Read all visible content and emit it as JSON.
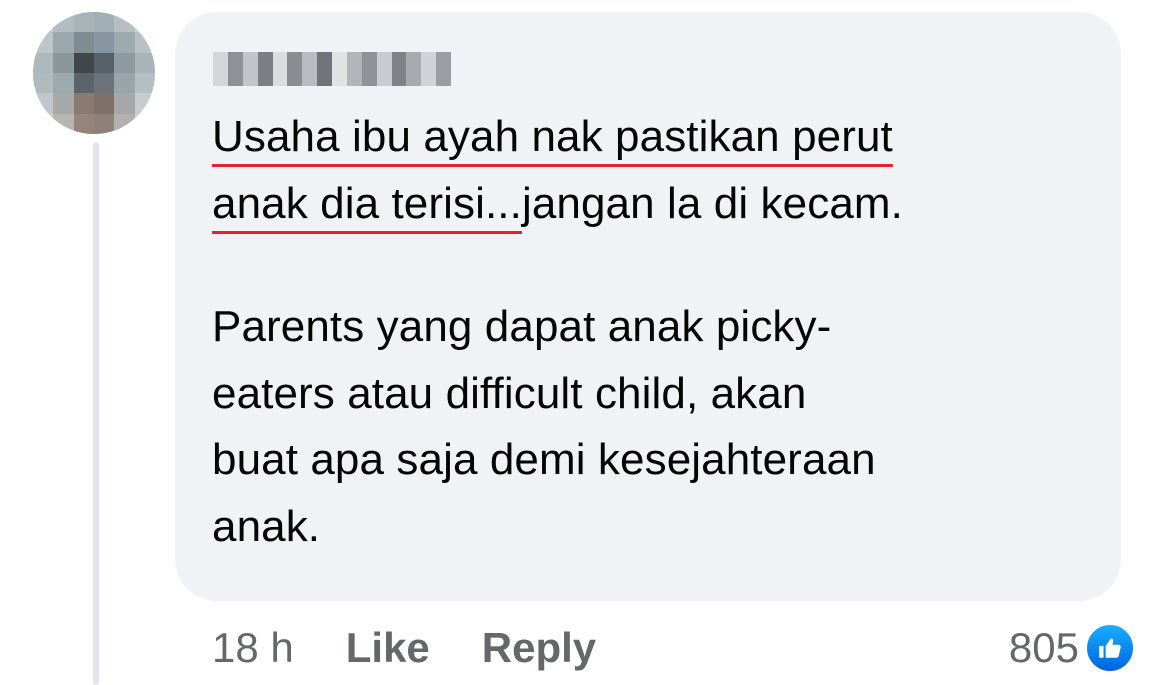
{
  "comment": {
    "author_name": "Author name (pixelated)",
    "paragraphs": [
      {
        "lines": [
          {
            "text": "Usaha ibu ayah nak pastikan perut",
            "underlined": true
          },
          {
            "underlined_part": "anak dia terisi...",
            "text": "jangan la di kecam."
          }
        ]
      },
      {
        "lines": [
          {
            "text": "Parents yang dapat anak picky-"
          },
          {
            "text": "eaters atau difficult child, akan"
          },
          {
            "text": "buat apa saja demi kesejahteraan"
          },
          {
            "text": "anak."
          }
        ]
      }
    ]
  },
  "actions": {
    "time": "18 h",
    "like_label": "Like",
    "reply_label": "Reply"
  },
  "reactions": {
    "count": "805",
    "icon": "thumbs-up-icon",
    "color": "#1877f2"
  },
  "colors": {
    "bubble": "#f0f2f5",
    "underline": "#e0262c",
    "muted_text": "#65676b"
  }
}
